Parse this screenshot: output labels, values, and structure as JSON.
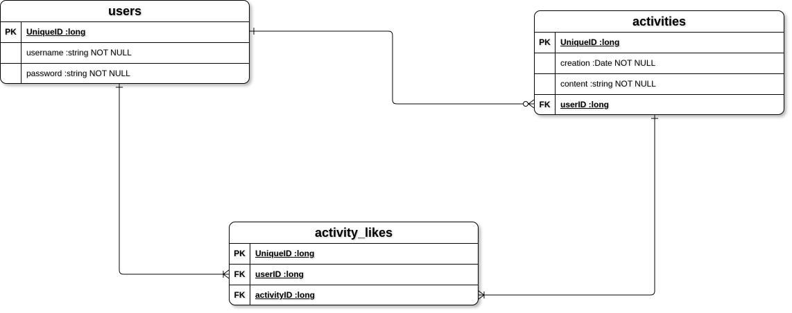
{
  "entities": {
    "users": {
      "title": "users",
      "rows": [
        {
          "key": "PK",
          "field": "UniqueID :long",
          "kind": "pk"
        },
        {
          "key": "",
          "field": "username :string NOT NULL",
          "kind": "attr"
        },
        {
          "key": "",
          "field": "password :string NOT NULL",
          "kind": "attr"
        }
      ]
    },
    "activities": {
      "title": "activities",
      "rows": [
        {
          "key": "PK",
          "field": "UniqueID :long",
          "kind": "pk"
        },
        {
          "key": "",
          "field": "creation :Date NOT NULL",
          "kind": "attr"
        },
        {
          "key": "",
          "field": "content :string NOT NULL",
          "kind": "attr"
        },
        {
          "key": "FK",
          "field": "userID :long",
          "kind": "fk"
        }
      ]
    },
    "activity_likes": {
      "title": "activity_likes",
      "rows": [
        {
          "key": "PK",
          "field": "UniqueID :long",
          "kind": "pk"
        },
        {
          "key": "FK",
          "field": "userID :long",
          "kind": "fk"
        },
        {
          "key": "FK",
          "field": "activityID :long",
          "kind": "fk"
        }
      ]
    }
  },
  "relationships": [
    {
      "from": "users.UniqueID",
      "to": "activities.userID",
      "from_cardinality": "one",
      "to_cardinality": "zero-or-many"
    },
    {
      "from": "users.UniqueID",
      "to": "activity_likes.userID",
      "from_cardinality": "one",
      "to_cardinality": "one-or-many"
    },
    {
      "from": "activities.UniqueID",
      "to": "activity_likes.activityID",
      "from_cardinality": "one",
      "to_cardinality": "one-or-many"
    }
  ]
}
